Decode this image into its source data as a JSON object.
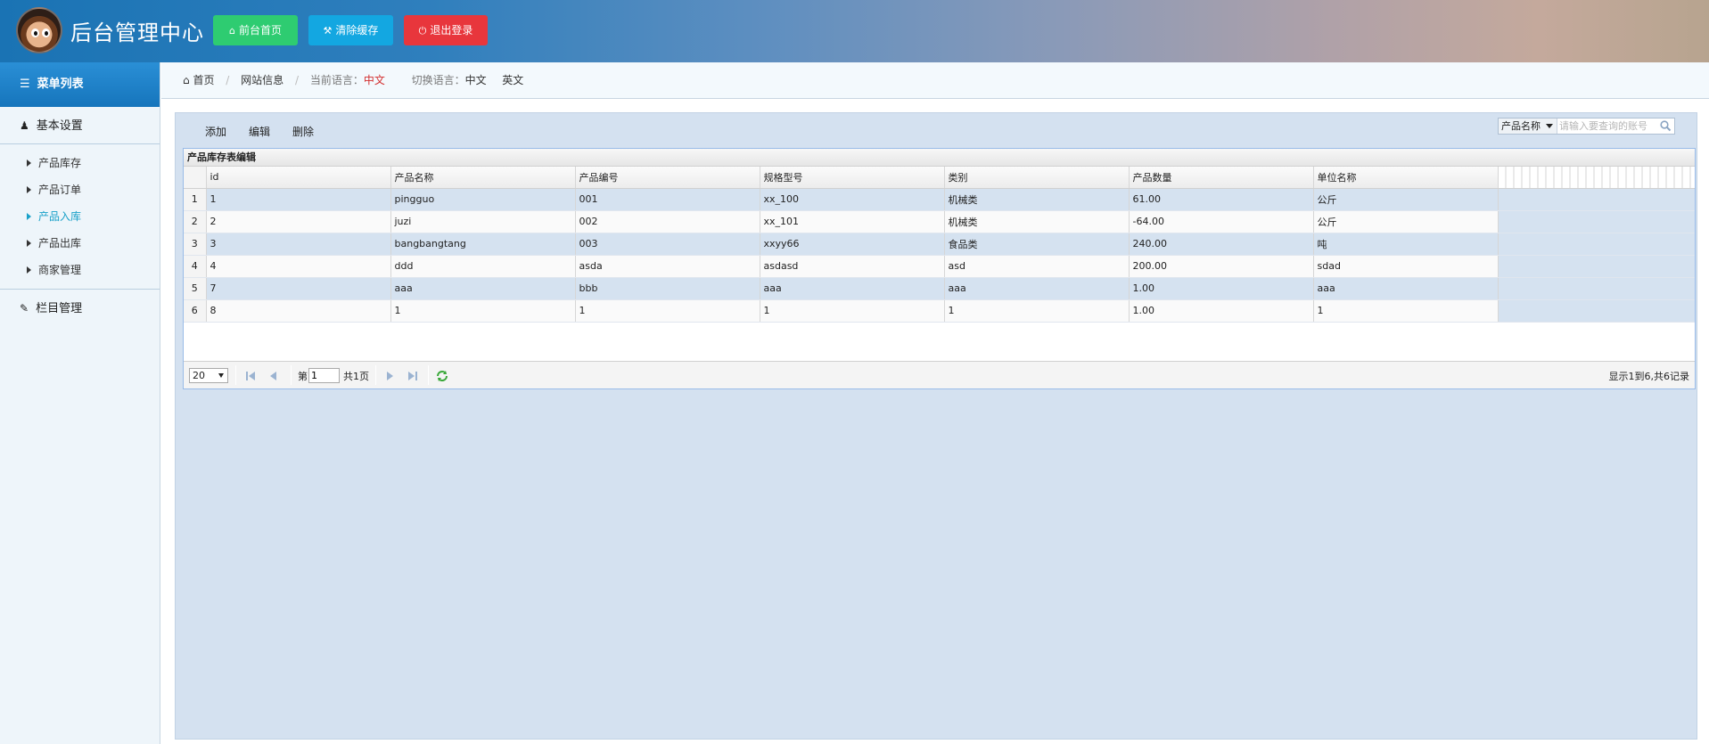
{
  "header": {
    "title": "后台管理中心",
    "home_btn": "前台首页",
    "cache_btn": "清除缓存",
    "logout_btn": "退出登录"
  },
  "sidebar": {
    "menu_title": "菜单列表",
    "group_basic": "基本设置",
    "items": [
      {
        "label": "产品库存",
        "active": false
      },
      {
        "label": "产品订单",
        "active": false
      },
      {
        "label": "产品入库",
        "active": true
      },
      {
        "label": "产品出库",
        "active": false
      },
      {
        "label": "商家管理",
        "active": false
      }
    ],
    "group_column": "栏目管理"
  },
  "breadcrumb": {
    "home": "首页",
    "site_info": "网站信息",
    "current_lang_label": "当前语言：",
    "current_lang": "中文",
    "switch_lang_label": "切换语言：",
    "lang_zh": "中文",
    "lang_en": "英文"
  },
  "toolbar": {
    "add": "添加",
    "edit": "编辑",
    "delete": "删除",
    "search_field": "产品名称",
    "search_placeholder": "请输入要查询的账号"
  },
  "grid": {
    "title": "产品库存表编辑",
    "columns": [
      "id",
      "产品名称",
      "产品编号",
      "规格型号",
      "类别",
      "产品数量",
      "单位名称"
    ],
    "rows": [
      {
        "rn": "1",
        "cells": [
          "1",
          "pingguo",
          "001",
          "xx_100",
          "机械类",
          "61.00",
          "公斤"
        ]
      },
      {
        "rn": "2",
        "cells": [
          "2",
          "juzi",
          "002",
          "xx_101",
          "机械类",
          "-64.00",
          "公斤"
        ]
      },
      {
        "rn": "3",
        "cells": [
          "3",
          "bangbangtang",
          "003",
          "xxyy66",
          "食品类",
          "240.00",
          "吨"
        ]
      },
      {
        "rn": "4",
        "cells": [
          "4",
          "ddd",
          "asda",
          "asdasd",
          "asd",
          "200.00",
          "sdad"
        ]
      },
      {
        "rn": "5",
        "cells": [
          "7",
          "aaa",
          "bbb",
          "aaa",
          "aaa",
          "1.00",
          "aaa"
        ]
      },
      {
        "rn": "6",
        "cells": [
          "8",
          "1",
          "1",
          "1",
          "1",
          "1.00",
          "1"
        ]
      }
    ]
  },
  "pager": {
    "page_size": "20",
    "page_prefix": "第",
    "page_value": "1",
    "page_total": "共1页",
    "summary": "显示1到6,共6记录"
  }
}
